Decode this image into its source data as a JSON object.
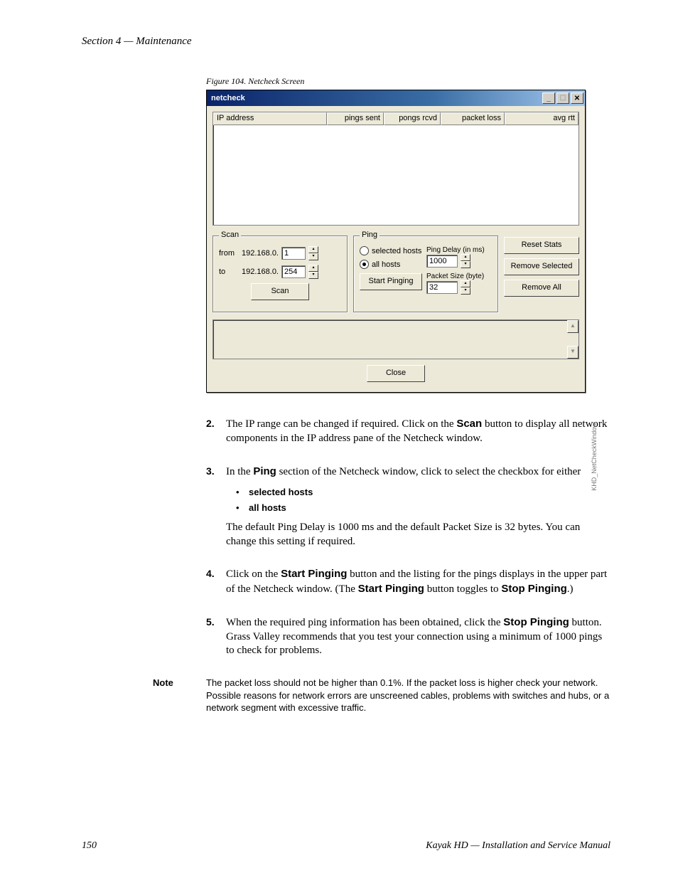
{
  "header": {
    "section": "Section 4 — Maintenance"
  },
  "figure": {
    "caption": "Figure 104.  Netcheck Screen"
  },
  "window": {
    "title": "netcheck",
    "columns": {
      "ip": "IP address",
      "sent": "pings sent",
      "rcvd": "pongs rcvd",
      "loss": "packet loss",
      "rtt": "avg rtt"
    },
    "scan": {
      "legend": "Scan",
      "from_lbl": "from",
      "from_ip": "192.168.0.",
      "from_val": "1",
      "to_lbl": "to",
      "to_ip": "192.168.0.",
      "to_val": "254",
      "button": "Scan"
    },
    "ping": {
      "legend": "Ping",
      "opt_sel": "selected hosts",
      "opt_all": "all hosts",
      "delay_lbl": "Ping Delay (in ms)",
      "delay_val": "1000",
      "size_lbl": "Packet Size (byte)",
      "size_val": "32",
      "start": "Start Pinging"
    },
    "side": {
      "reset": "Reset Stats",
      "remove_sel": "Remove Selected",
      "remove_all": "Remove All"
    },
    "close": "Close",
    "side_tag": "KHD_NetCheckWindow"
  },
  "steps": {
    "s2": {
      "num": "2.",
      "t1a": "The IP range can be changed if required. Click on the ",
      "t1b": "Scan",
      "t1c": " button to display all network components in the IP address pane of the Netcheck window."
    },
    "s3": {
      "num": "3.",
      "t1a": "In the ",
      "t1b": "Ping",
      "t1c": " section of the Netcheck window, click to select the checkbox for either",
      "b1": "selected hosts",
      "b2": "all hosts",
      "t2": "The default Ping Delay is 1000 ms and the default Packet Size is 32 bytes. You can change this setting if required."
    },
    "s4": {
      "num": "4.",
      "t1a": "Click on the ",
      "t1b": "Start Pinging",
      "t1c": " button and the listing for the pings displays in the upper part of the Netcheck window. (The ",
      "t1d": "Start Pinging",
      "t1e": " button toggles to ",
      "t1f": "Stop Pinging",
      "t1g": ".)"
    },
    "s5": {
      "num": "5.",
      "t1a": "When the required ping information has been obtained, click the ",
      "t1b": "Stop Pinging",
      "t1c": " button. Grass Valley recommends that you test your connection using a minimum of 1000 pings to check for problems."
    }
  },
  "note": {
    "label": "Note",
    "body": "The packet loss should not be higher than 0.1%. If the packet loss is higher check your network. Possible reasons for network errors are unscreened cables, problems with switches and hubs, or a network segment with excessive traffic."
  },
  "footer": {
    "page": "150",
    "book": "Kayak HD  —  Installation and Service Manual"
  }
}
